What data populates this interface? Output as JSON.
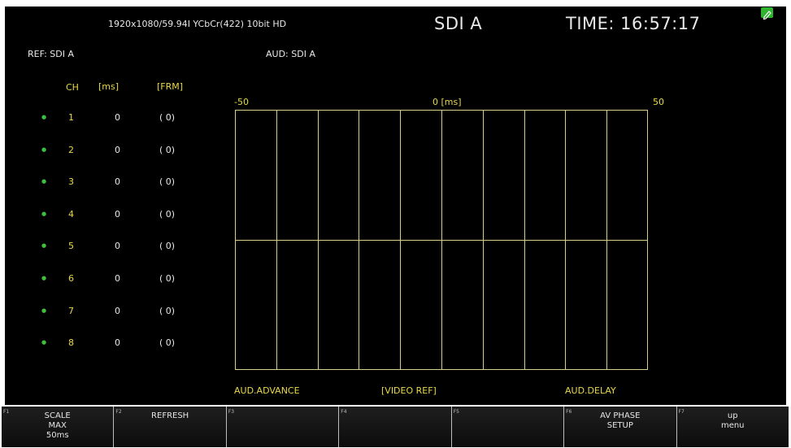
{
  "header": {
    "format": "1920x1080/59.94I YCbCr(422) 10bit HD",
    "input": "SDI A",
    "time": "TIME: 16:57:17"
  },
  "ref": "REF: SDI A",
  "aud": "AUD: SDI A",
  "table": {
    "columns": [
      "CH",
      "[ms]",
      "[FRM]"
    ],
    "rows": [
      {
        "ch": "1",
        "ms": "0",
        "frm": "(   0)"
      },
      {
        "ch": "2",
        "ms": "0",
        "frm": "(   0)"
      },
      {
        "ch": "3",
        "ms": "0",
        "frm": "(   0)"
      },
      {
        "ch": "4",
        "ms": "0",
        "frm": "(   0)"
      },
      {
        "ch": "5",
        "ms": "0",
        "frm": "(   0)"
      },
      {
        "ch": "6",
        "ms": "0",
        "frm": "(   0)"
      },
      {
        "ch": "7",
        "ms": "0",
        "frm": "(   0)"
      },
      {
        "ch": "8",
        "ms": "0",
        "frm": "(   0)"
      }
    ]
  },
  "scale": {
    "left": "-50",
    "center": "0 [ms]",
    "right": "50",
    "min_ms": -50,
    "max_ms": 50,
    "divisions": 10
  },
  "bottom_labels": {
    "advance": "AUD.ADVANCE",
    "ref": "[VIDEO REF]",
    "delay": "AUD.DELAY"
  },
  "fkeys": [
    {
      "num": "F1",
      "lines": [
        "SCALE",
        "MAX",
        "50ms"
      ]
    },
    {
      "num": "F2",
      "lines": [
        "REFRESH"
      ]
    },
    {
      "num": "F3",
      "lines": []
    },
    {
      "num": "F4",
      "lines": []
    },
    {
      "num": "F5",
      "lines": []
    },
    {
      "num": "F6",
      "lines": [
        "AV PHASE",
        "SETUP"
      ]
    },
    {
      "num": "F7",
      "lines": [
        "up",
        "menu"
      ]
    }
  ],
  "colors": {
    "background": "#000000",
    "label_yellow": "#e8d84a",
    "grid": "#d8cf8a",
    "status_dot": "#3fbf3f",
    "edit_icon": "#2fb32f"
  },
  "icons": {
    "edit": "pencil-icon",
    "status": "dot-icon"
  }
}
